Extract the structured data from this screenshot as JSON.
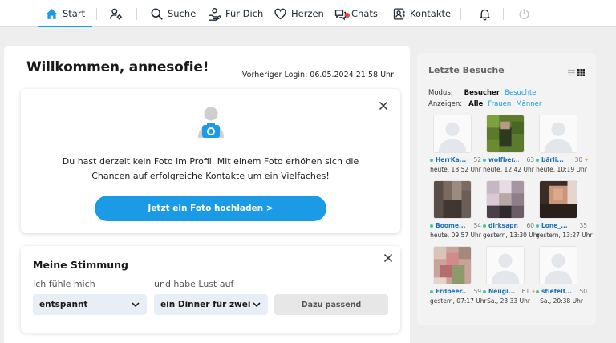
{
  "nav": {
    "start": "Start",
    "suche": "Suche",
    "fuer_dich": "Für Dich",
    "herzen": "Herzen",
    "chats": "Chats",
    "kontakte": "Kontakte",
    "active_color": "#1a9be6"
  },
  "main": {
    "welcome": "Willkommen, annesofie!",
    "last_login": "Vorheriger Login: 06.05.2024 21:58 Uhr"
  },
  "photo_prompt": {
    "text": "Du hast derzeit kein Foto im Profil. Mit einem Foto erhöhen sich die Chancen auf erfolgreiche Kontakte um ein Vielfaches!",
    "button": "Jetzt ein Foto hochladen >",
    "button_color": "#1b9be6"
  },
  "mood": {
    "title": "Meine Stimmung",
    "feel_label": "Ich fühle mich",
    "feel_value": "entspannt",
    "desire_label": "und habe Lust auf",
    "desire_value": "ein Dinner für zwei",
    "submit": "Dazu passend"
  },
  "visits": {
    "title": "Letzte Besuche",
    "mode_label": "Modus:",
    "mode_options": [
      "Besucher",
      "Besuchte"
    ],
    "mode_selected": "Besucher",
    "show_label": "Anzeigen:",
    "show_options": [
      "Alle",
      "Frauen",
      "Männer"
    ],
    "show_selected": "Alle",
    "items": [
      {
        "name": "HerrKa...",
        "age": "52",
        "time": "heute, 18:52 Uhr",
        "photo": "placeholder",
        "badge": ""
      },
      {
        "name": "wolfber...",
        "age": "63",
        "time": "heute, 12:42 Uhr",
        "photo": "green",
        "badge": ""
      },
      {
        "name": "bärli...",
        "age": "30",
        "time": "heute, 10:19 Uhr",
        "photo": "placeholder",
        "badge": "✦"
      },
      {
        "name": "Boome...",
        "age": "54",
        "time": "heute, 09:57 Uhr",
        "photo": "brown",
        "badge": ""
      },
      {
        "name": "dirksapn",
        "age": "60",
        "time": "gestern, 13:30 Uhr",
        "photo": "mosaic",
        "badge": ""
      },
      {
        "name": "Lone_...",
        "age": "35",
        "time": "gestern, 13:27 Uhr",
        "photo": "face",
        "badge": ""
      },
      {
        "name": "Erdbeer...",
        "age": "59",
        "time": "gestern, 07:17 Uhr",
        "photo": "pink",
        "badge": ""
      },
      {
        "name": "Neugi...",
        "age": "61",
        "time": "Sa., 23:33 Uhr",
        "photo": "placeholder",
        "badge": "✦"
      },
      {
        "name": "stiefelf...",
        "age": "50",
        "time": "Sa., 20:38 Uhr",
        "photo": "placeholder",
        "badge": ""
      }
    ]
  }
}
